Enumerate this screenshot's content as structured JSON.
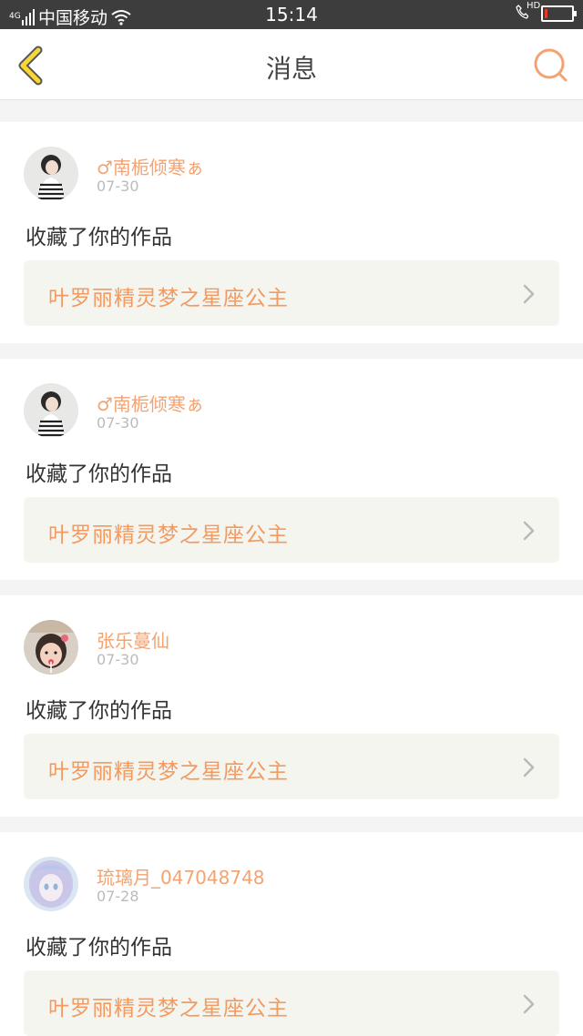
{
  "status_bar": {
    "network": "4G",
    "carrier": "中国移动",
    "time": "15:14",
    "call_hd": "HD",
    "battery_level": 0.08,
    "battery_color": "#e23b2a"
  },
  "header": {
    "title": "消息",
    "back_icon": "chevron-left-icon",
    "search_icon": "search-icon",
    "accent": "#f3a372"
  },
  "messages": [
    {
      "username": "♂南栀倾寒ぁ",
      "date": "07-30",
      "action": "收藏了你的作品",
      "work_title": "叶罗丽精灵梦之星座公主",
      "avatar": "girl-striped-shirt-avatar"
    },
    {
      "username": "♂南栀倾寒ぁ",
      "date": "07-30",
      "action": "收藏了你的作品",
      "work_title": "叶罗丽精灵梦之星座公主",
      "avatar": "girl-striped-shirt-avatar"
    },
    {
      "username": "张乐蔓仙",
      "date": "07-30",
      "action": "收藏了你的作品",
      "work_title": "叶罗丽精灵梦之星座公主",
      "avatar": "child-selfie-avatar"
    },
    {
      "username": "琉璃月_047048748",
      "date": "07-28",
      "action": "收藏了你的作品",
      "work_title": "叶罗丽精灵梦之星座公主",
      "avatar": "anime-girl-avatar"
    }
  ]
}
